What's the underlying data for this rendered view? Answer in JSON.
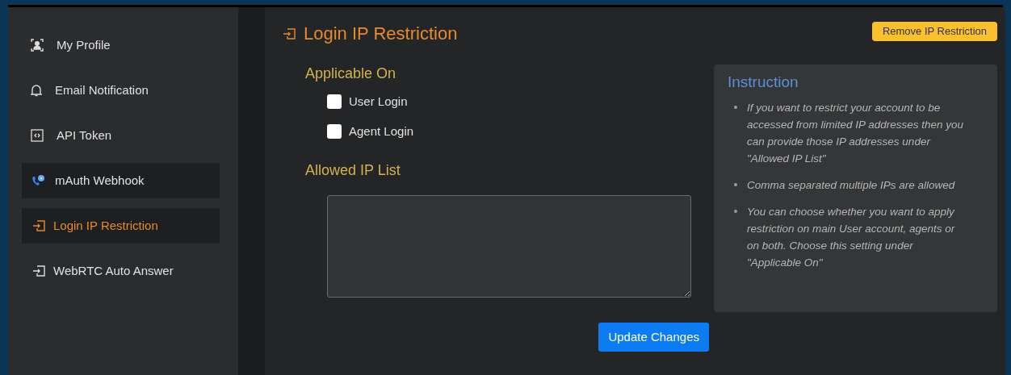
{
  "sidebar": {
    "items": [
      {
        "label": "My Profile",
        "kind": "profile",
        "selected": false,
        "highlighted": false
      },
      {
        "label": "Email Notification",
        "kind": "bell",
        "selected": false,
        "highlighted": false
      },
      {
        "label": "API Token",
        "kind": "code",
        "selected": false,
        "highlighted": false
      },
      {
        "label": "mAuth Webhook",
        "kind": "phone",
        "selected": false,
        "highlighted": true
      },
      {
        "label": "Login IP Restriction",
        "kind": "login",
        "selected": true,
        "highlighted": true
      },
      {
        "label": "WebRTC Auto Answer",
        "kind": "login",
        "selected": false,
        "highlighted": false
      }
    ]
  },
  "page": {
    "title": "Login IP Restriction",
    "remove_button": "Remove IP Restriction"
  },
  "applicable_on": {
    "heading": "Applicable On",
    "options": [
      {
        "label": "User Login",
        "checked": false
      },
      {
        "label": "Agent Login",
        "checked": false
      }
    ]
  },
  "allowed_ip": {
    "heading": "Allowed IP List"
  },
  "update_button": "Update Changes",
  "instruction": {
    "title": "Instruction",
    "items": [
      "If you want to restrict your account to be accessed from limited IP addresses then you can provide those IP addresses under \"Allowed IP List\"",
      "Comma separated multiple IPs are allowed",
      "You can choose whether you want to apply restriction on main User account, agents or on both. Choose this setting under \"Applicable On\""
    ]
  }
}
